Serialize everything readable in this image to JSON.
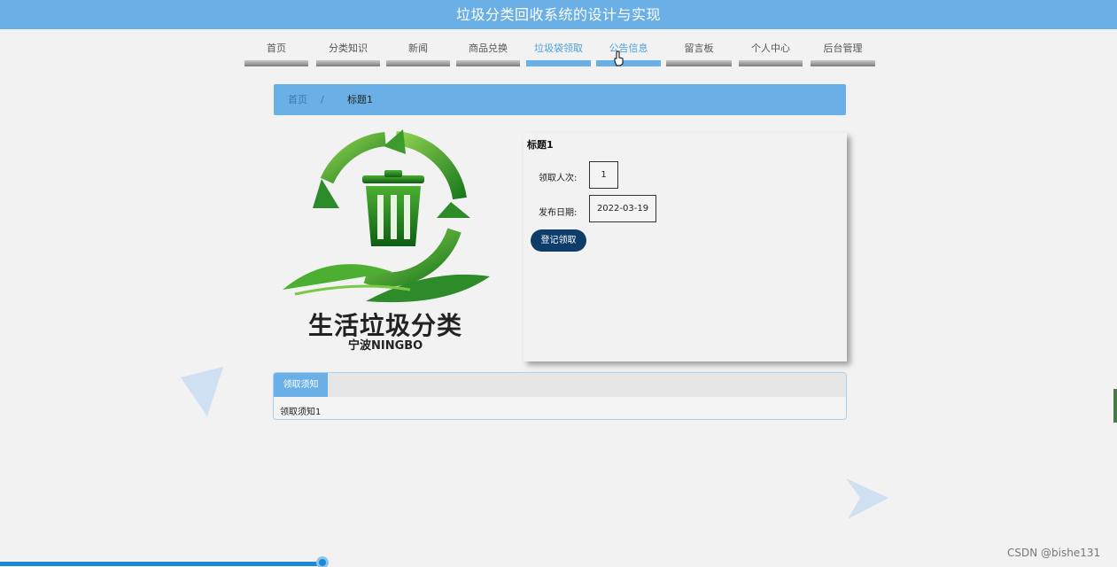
{
  "header": {
    "title": "垃圾分类回收系统的设计与实现"
  },
  "nav": {
    "items": [
      {
        "label": "首页"
      },
      {
        "label": "分类知识"
      },
      {
        "label": "新闻"
      },
      {
        "label": "商品兑换"
      },
      {
        "label": "垃圾袋领取"
      },
      {
        "label": "公告信息"
      },
      {
        "label": "留言板"
      },
      {
        "label": "个人中心"
      },
      {
        "label": "后台管理"
      }
    ],
    "active": "垃圾袋领取",
    "hover": "公告信息"
  },
  "breadcrumb": {
    "home": "首页",
    "separator": "/",
    "current": "标题1"
  },
  "logo": {
    "title": "生活垃圾分类",
    "subtitle": "宁波NINGBO"
  },
  "detail": {
    "title": "标题1",
    "count_label": "领取人次:",
    "count_value": "1",
    "date_label": "发布日期:",
    "date_value": "2022-03-19",
    "button": "登记领取"
  },
  "notice": {
    "tab": "领取须知",
    "content": "领取须知1"
  },
  "watermark": "CSDN @bishe131",
  "colors": {
    "primary": "#6ab0e6",
    "button": "#0f3d6b",
    "background": "#f2f2f2"
  }
}
